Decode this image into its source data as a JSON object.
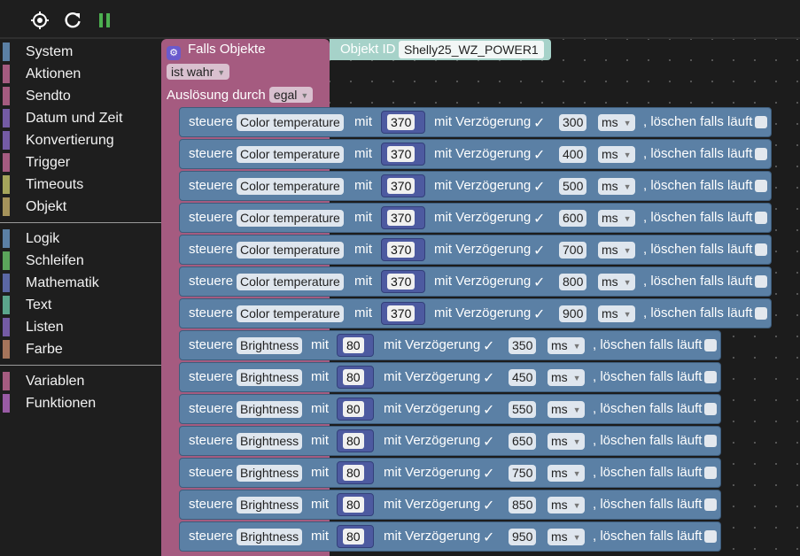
{
  "toolbar": {
    "icons": [
      "target-icon",
      "refresh-icon",
      "pause-icon"
    ],
    "accent": "#4caf50"
  },
  "sidebar": {
    "groups": [
      [
        {
          "label": "System",
          "color": "#5b80a5"
        },
        {
          "label": "Aktionen",
          "color": "#a55b80"
        },
        {
          "label": "Sendto",
          "color": "#a55b80"
        },
        {
          "label": "Datum und Zeit",
          "color": "#745ba5"
        },
        {
          "label": "Konvertierung",
          "color": "#745ba5"
        },
        {
          "label": "Trigger",
          "color": "#a55b80"
        },
        {
          "label": "Timeouts",
          "color": "#a5a55b"
        },
        {
          "label": "Objekt",
          "color": "#a5935b"
        }
      ],
      [
        {
          "label": "Logik",
          "color": "#5b80a5"
        },
        {
          "label": "Schleifen",
          "color": "#5ba55b"
        },
        {
          "label": "Mathematik",
          "color": "#5b67a5"
        },
        {
          "label": "Text",
          "color": "#5ba58c"
        },
        {
          "label": "Listen",
          "color": "#745ba5"
        },
        {
          "label": "Farbe",
          "color": "#a5745b"
        }
      ],
      [
        {
          "label": "Variablen",
          "color": "#a55b80"
        },
        {
          "label": "Funktionen",
          "color": "#995ba5"
        }
      ]
    ]
  },
  "trigger_block": {
    "title": "Falls Objekte",
    "condition": "ist wahr",
    "trigger_label": "Auslösung durch",
    "trigger_value": "egal",
    "object_label": "Objekt ID",
    "object_value": "Shelly25_WZ_POWER1"
  },
  "statements": [
    {
      "steuere": "steuere",
      "state": "Color temperature",
      "mit": "mit",
      "value": "370",
      "delay_label": "mit Verzögerung",
      "check": "✓",
      "delay": "300",
      "unit": "ms",
      "clear_label": ", löschen falls läuft"
    },
    {
      "steuere": "steuere",
      "state": "Color temperature",
      "mit": "mit",
      "value": "370",
      "delay_label": "mit Verzögerung",
      "check": "✓",
      "delay": "400",
      "unit": "ms",
      "clear_label": ", löschen falls läuft"
    },
    {
      "steuere": "steuere",
      "state": "Color temperature",
      "mit": "mit",
      "value": "370",
      "delay_label": "mit Verzögerung",
      "check": "✓",
      "delay": "500",
      "unit": "ms",
      "clear_label": ", löschen falls läuft"
    },
    {
      "steuere": "steuere",
      "state": "Color temperature",
      "mit": "mit",
      "value": "370",
      "delay_label": "mit Verzögerung",
      "check": "✓",
      "delay": "600",
      "unit": "ms",
      "clear_label": ", löschen falls läuft"
    },
    {
      "steuere": "steuere",
      "state": "Color temperature",
      "mit": "mit",
      "value": "370",
      "delay_label": "mit Verzögerung",
      "check": "✓",
      "delay": "700",
      "unit": "ms",
      "clear_label": ", löschen falls läuft"
    },
    {
      "steuere": "steuere",
      "state": "Color temperature",
      "mit": "mit",
      "value": "370",
      "delay_label": "mit Verzögerung",
      "check": "✓",
      "delay": "800",
      "unit": "ms",
      "clear_label": ", löschen falls läuft"
    },
    {
      "steuere": "steuere",
      "state": "Color temperature",
      "mit": "mit",
      "value": "370",
      "delay_label": "mit Verzögerung",
      "check": "✓",
      "delay": "900",
      "unit": "ms",
      "clear_label": ", löschen falls läuft"
    },
    {
      "steuere": "steuere",
      "state": "Brightness",
      "mit": "mit",
      "value": "80",
      "delay_label": "mit Verzögerung",
      "check": "✓",
      "delay": "350",
      "unit": "ms",
      "clear_label": ", löschen falls läuft"
    },
    {
      "steuere": "steuere",
      "state": "Brightness",
      "mit": "mit",
      "value": "80",
      "delay_label": "mit Verzögerung",
      "check": "✓",
      "delay": "450",
      "unit": "ms",
      "clear_label": ", löschen falls läuft"
    },
    {
      "steuere": "steuere",
      "state": "Brightness",
      "mit": "mit",
      "value": "80",
      "delay_label": "mit Verzögerung",
      "check": "✓",
      "delay": "550",
      "unit": "ms",
      "clear_label": ", löschen falls läuft"
    },
    {
      "steuere": "steuere",
      "state": "Brightness",
      "mit": "mit",
      "value": "80",
      "delay_label": "mit Verzögerung",
      "check": "✓",
      "delay": "650",
      "unit": "ms",
      "clear_label": ", löschen falls läuft"
    },
    {
      "steuere": "steuere",
      "state": "Brightness",
      "mit": "mit",
      "value": "80",
      "delay_label": "mit Verzögerung",
      "check": "✓",
      "delay": "750",
      "unit": "ms",
      "clear_label": ", löschen falls läuft"
    },
    {
      "steuere": "steuere",
      "state": "Brightness",
      "mit": "mit",
      "value": "80",
      "delay_label": "mit Verzögerung",
      "check": "✓",
      "delay": "850",
      "unit": "ms",
      "clear_label": ", löschen falls läuft"
    },
    {
      "steuere": "steuere",
      "state": "Brightness",
      "mit": "mit",
      "value": "80",
      "delay_label": "mit Verzögerung",
      "check": "✓",
      "delay": "950",
      "unit": "ms",
      "clear_label": ", löschen falls läuft"
    }
  ]
}
